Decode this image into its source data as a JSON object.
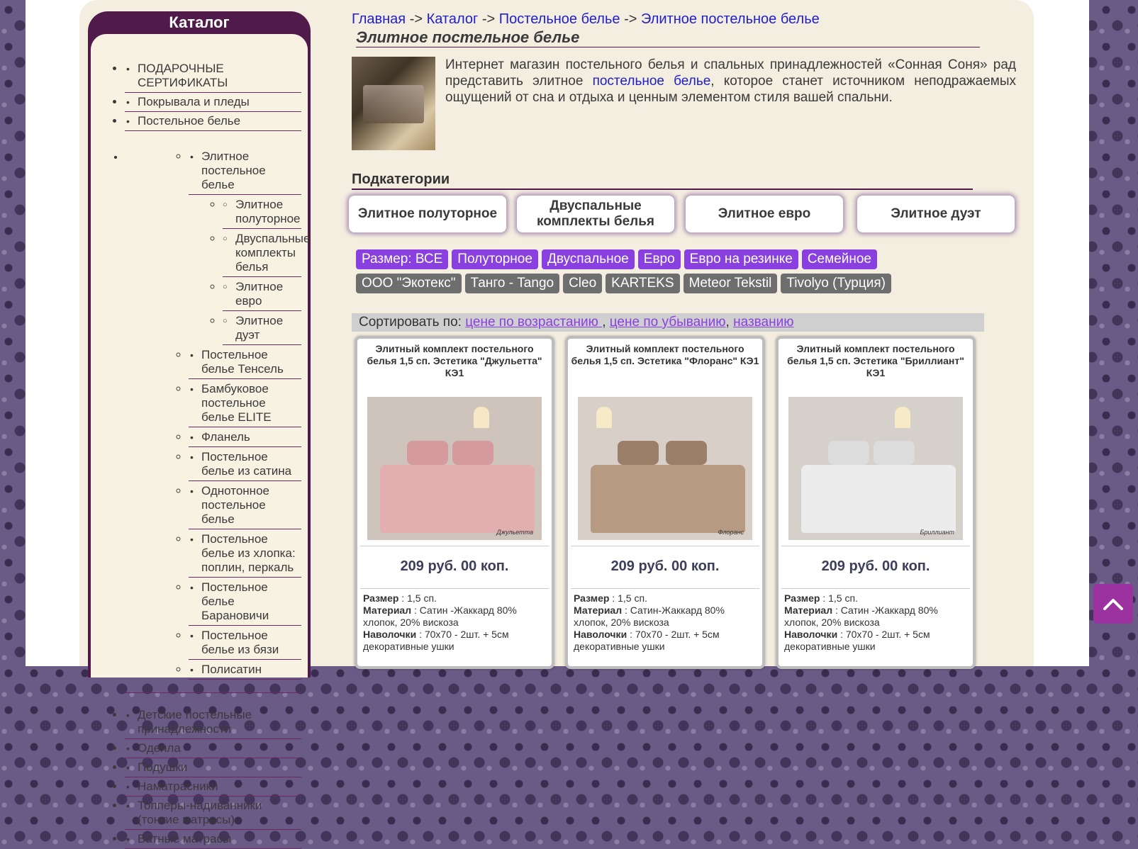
{
  "sidebar": {
    "title": "Каталог",
    "top_items": [
      "ПОДАРОЧНЫЕ СЕРТИФИКАТЫ",
      "Покрывала и пледы",
      "Постельное белье"
    ],
    "sub_item_active": "Элитное постельное белье",
    "subsub_items": [
      "Элитное полуторное",
      "Двуспальные комплекты белья",
      "Элитное евро",
      "Элитное дуэт"
    ],
    "sub_items": [
      "Постельное белье Тенсель",
      "Бамбуковое постельное белье ELITE",
      "Фланель",
      "Постельное белье из сатина",
      "Однотонное постельное белье",
      "Постельное белье из хлопка: поплин, перкаль",
      "Постельное белье Барановичи",
      "Постельное белье из бязи",
      "Полисатин"
    ],
    "bottom_items": [
      "Детские постельные принадлежности",
      "Одеяла",
      "Подушки",
      "Наматрасники",
      "Топперы-надиванники (тонкие матрасы)",
      "Ватные матрасы"
    ]
  },
  "breadcrumb": {
    "home": "Главная",
    "catalog": "Каталог",
    "bedding": "Постельное белье",
    "current": "Элитное постельное белье",
    "separator": "->"
  },
  "page_title": "Элитное постельное белье",
  "intro": {
    "text_before": "Интернет магазин постельного белья и спальных принадлежностей «Сонная Соня» рад представить элитное ",
    "link": "постельное белье",
    "text_after": ", которое станет источником неподражаемых ощущений от сна и отдыха и ценным элементом стиля вашей спальни."
  },
  "subcategories": {
    "heading": "Подкатегории",
    "items": [
      "Элитное полуторное",
      "Двуспальные комплекты белья",
      "Элитное евро",
      "Элитное дуэт"
    ]
  },
  "size_filters": [
    "Размер: ВСЕ",
    "Полуторное",
    "Двуспальное",
    "Евро",
    "Евро на резинке",
    "Семейное"
  ],
  "brand_filters": [
    "ООО \"Экотекс\"",
    "Танго - Tango",
    "Cleo",
    "KARTEKS",
    "Meteor Tekstil",
    "Tivolyo (Турция)"
  ],
  "sort": {
    "label": "Сортировать по: ",
    "options": [
      "цене по возрастанию ",
      "цене по убыванию",
      "названию"
    ]
  },
  "products": [
    {
      "name": "Элитный комплект постельного белья 1,5 сп. Эстетика \"Джульетта\" КЭ1",
      "price": "209 руб. 00 коп.",
      "image_label": "Джульетта",
      "bed_color": "#e2aeb0",
      "pillow_color": "#d49a9e",
      "bg_color": "#cfc4bc",
      "specs": [
        {
          "key": "Размер",
          "value": " : 1,5 сп."
        },
        {
          "key": "Материал",
          "value": " : Сатин -Жаккард 80% хлопок, 20% вискоза"
        },
        {
          "key": "Наволочки",
          "value": " : 70х70 - 2шт. + 5см декоративные ушки"
        }
      ]
    },
    {
      "name": "Элитный комплект постельного белья 1,5 сп. Эстетика \"Флоранс\" КЭ1",
      "price": "209 руб. 00 коп.",
      "image_label": "Флоранс",
      "bed_color": "#b69a82",
      "pillow_color": "#9c7f68",
      "bg_color": "#d8d0c8",
      "specs": [
        {
          "key": "Размер",
          "value": " : 1,5 сп."
        },
        {
          "key": "Материал",
          "value": " : Сатин-Жаккард 80% хлопок, 20% вискоза"
        },
        {
          "key": "Наволочки",
          "value": " : 70х70 - 2шт. + 5см декоративные ушки"
        }
      ]
    },
    {
      "name": "Элитный комплект постельного белья 1,5 сп. Эстетика \"Бриллиант\" КЭ1",
      "price": "209 руб. 00 коп.",
      "image_label": "Бриллиант",
      "bed_color": "#ececec",
      "pillow_color": "#dcdcdc",
      "bg_color": "#d6d0ca",
      "specs": [
        {
          "key": "Размер",
          "value": " : 1,5 сп."
        },
        {
          "key": "Материал",
          "value": " : Сатин -Жаккард 80% хлопок, 20% вискоза"
        },
        {
          "key": "Наволочки",
          "value": " : 70х70 - 2шт. + 5см декоративные ушки"
        }
      ]
    }
  ],
  "colors": {
    "accent_purple": "#8a3fe0",
    "sidebar_dark": "#501a4a",
    "link_blue": "#2020c8",
    "scroll_button": "#9b32a0"
  },
  "icons": {
    "scroll_top": "chevron-up-icon"
  }
}
